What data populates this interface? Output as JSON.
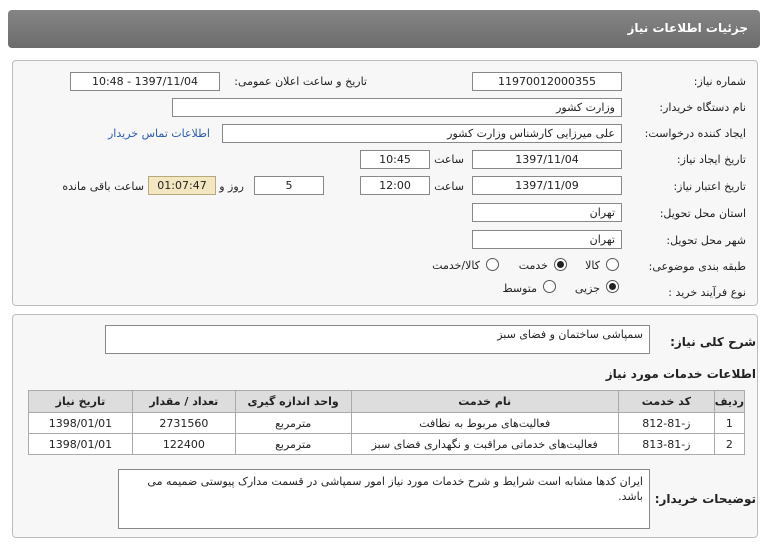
{
  "title": "جزئیات اطلاعات نیاز",
  "form": {
    "need_number_label": "شماره نیاز:",
    "need_number": "11970012000355",
    "announce_label": "تاریخ و ساعت اعلان عمومی:",
    "announce_value": "1397/11/04 - 10:48",
    "buyer_org_label": "نام دستگاه خریدار:",
    "buyer_org": "وزارت کشور",
    "creator_label": "ایجاد کننده درخواست:",
    "creator": "علی میرزایی کارشناس وزارت کشور",
    "contact_link": "اطلاعات تماس خریدار",
    "created_date_label": "تاریخ ایجاد نیاز:",
    "created_date": "1397/11/04",
    "time_label": "ساعت",
    "created_time": "10:45",
    "validity_label": "تاریخ اعتبار نیاز:",
    "validity_date": "1397/11/09",
    "validity_time": "12:00",
    "days_label": "روز و",
    "days": "5",
    "remaining_time": "01:07:47",
    "remaining_label": "ساعت باقی مانده",
    "province_label": "استان محل تحویل:",
    "province": "تهران",
    "city_label": "شهر محل تحویل:",
    "city": "تهران",
    "category_label": "طبقه بندی موضوعی:",
    "category_options": [
      "کالا",
      "خدمت",
      "کالا/خدمت"
    ],
    "category_selected": "خدمت",
    "process_label": "نوع فرآیند خرید :",
    "process_options": [
      "جزیی",
      "متوسط"
    ],
    "process_selected": "جزیی"
  },
  "summary": {
    "label": "شرح کلی نیاز:",
    "value": "سمپاشی ساختمان و فضای سبز"
  },
  "services": {
    "heading": "اطلاعات خدمات مورد نیاز",
    "columns": [
      "ردیف",
      "کد خدمت",
      "نام خدمت",
      "واحد اندازه گیری",
      "تعداد / مقدار",
      "تاریخ نیاز"
    ],
    "rows": [
      [
        "1",
        "ز-81-812",
        "فعالیت‌های مربوط به نظافت",
        "مترمربع",
        "2731560",
        "1398/01/01"
      ],
      [
        "2",
        "ز-81-813",
        "فعالیت‌های خدماتی مراقبت و نگهداری فضای سبز",
        "مترمربع",
        "122400",
        "1398/01/01"
      ]
    ]
  },
  "buyer_notes": {
    "label": "توضیحات خریدار:",
    "value": "ایران کدها مشابه است شرایط و شرح خدمات مورد نیاز امور سمپاشی در قسمت مدارک پیوستی ضمیمه می باشد."
  }
}
